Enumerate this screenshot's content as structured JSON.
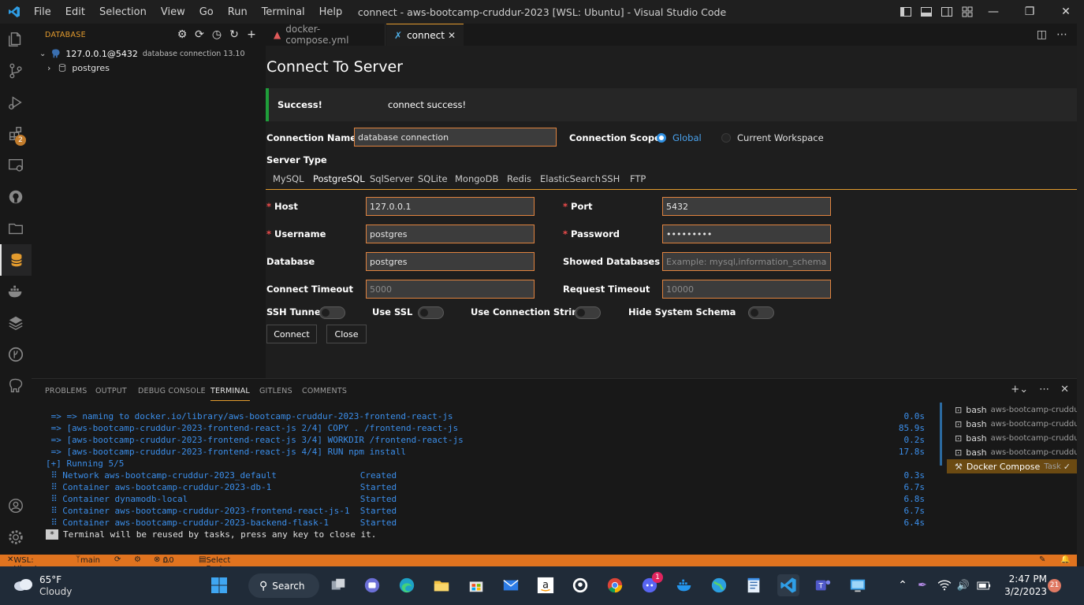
{
  "window": {
    "title": "connect - aws-bootcamp-cruddur-2023 [WSL: Ubuntu] - Visual Studio Code",
    "menu": [
      "File",
      "Edit",
      "Selection",
      "View",
      "Go",
      "Run",
      "Terminal",
      "Help"
    ]
  },
  "sidebar": {
    "title": "DATABASE",
    "connection": {
      "name": "127.0.0.1@5432",
      "detail": "database connection 13.10"
    },
    "db_item": "postgres",
    "extensions_badge": "2"
  },
  "tabs": [
    {
      "label": "docker-compose.yml",
      "icon": "docker-whale-icon"
    },
    {
      "label": "connect",
      "icon": "connect-plug-icon"
    }
  ],
  "form": {
    "heading": "Connect To Server",
    "success_label": "Success!",
    "success_msg": "connect success!",
    "conn_name_label": "Connection Name",
    "conn_name_value": "database connection",
    "scope_label": "Connection Scope",
    "scope_global": "Global",
    "scope_workspace": "Current Workspace",
    "server_type_label": "Server Type",
    "server_types": [
      "MySQL",
      "PostgreSQL",
      "SqlServer",
      "SQLite",
      "MongoDB",
      "Redis",
      "ElasticSearch",
      "SSH",
      "FTP"
    ],
    "host_label": "Host",
    "host_value": "127.0.0.1",
    "port_label": "Port",
    "port_value": "5432",
    "user_label": "Username",
    "user_value": "postgres",
    "pass_label": "Password",
    "pass_value": "•••••••••",
    "db_label": "Database",
    "db_value": "postgres",
    "showdb_label": "Showed Databases",
    "showdb_placeholder": "Example: mysql,information_schema",
    "ctimeout_label": "Connect Timeout",
    "ctimeout_value": "5000",
    "rtimeout_label": "Request Timeout",
    "rtimeout_value": "10000",
    "ssh_tunnel": "SSH Tunnel",
    "use_ssl": "Use SSL",
    "use_conn_string": "Use Connection String",
    "hide_schema": "Hide System Schema",
    "connect_btn": "Connect",
    "close_btn": "Close"
  },
  "panel": {
    "tabs": [
      "PROBLEMS",
      "OUTPUT",
      "DEBUG CONSOLE",
      "TERMINAL",
      "GITLENS",
      "COMMENTS"
    ],
    "lines": [
      {
        "text": " => => naming to docker.io/library/aws-bootcamp-cruddur-2023-frontend-react-js",
        "time": "0.0s"
      },
      {
        "text": " => [aws-bootcamp-cruddur-2023-frontend-react-js 2/4] COPY . /frontend-react-js",
        "time": "85.9s"
      },
      {
        "text": " => [aws-bootcamp-cruddur-2023-frontend-react-js 3/4] WORKDIR /frontend-react-js",
        "time": "0.2s"
      },
      {
        "text": " => [aws-bootcamp-cruddur-2023-frontend-react-js 4/4] RUN npm install",
        "time": "17.8s"
      },
      {
        "text": "[+] Running 5/5",
        "time": ""
      },
      {
        "text": " ⠿ Network aws-bootcamp-cruddur-2023_default                Created",
        "time": "0.3s"
      },
      {
        "text": " ⠿ Container aws-bootcamp-cruddur-2023-db-1                 Started",
        "time": "6.7s"
      },
      {
        "text": " ⠿ Container dynamodb-local                                 Started",
        "time": "6.8s"
      },
      {
        "text": " ⠿ Container aws-bootcamp-cruddur-2023-frontend-react-js-1  Started",
        "time": "6.7s"
      },
      {
        "text": " ⠿ Container aws-bootcamp-cruddur-2023-backend-flask-1      Started",
        "time": "6.4s"
      }
    ],
    "reuse_msg": "Terminal will be reused by tasks, press any key to close it.",
    "terminals": [
      {
        "name": "bash",
        "sub": "aws-bootcamp-cruddur..."
      },
      {
        "name": "bash",
        "sub": "aws-bootcamp-cruddur..."
      },
      {
        "name": "bash",
        "sub": "aws-bootcamp-cruddur..."
      },
      {
        "name": "bash",
        "sub": "aws-bootcamp-cruddur..."
      },
      {
        "name": "Docker Compose",
        "sub": "Task"
      }
    ]
  },
  "status": {
    "remote": "WSL: Ubuntu",
    "branch": "main",
    "errors": "0",
    "warnings": "0",
    "task": "Select Postgres Server"
  },
  "taskbar": {
    "temp": "65°F",
    "weather": "Cloudy",
    "search": "Search",
    "discord_badge": "1",
    "time": "2:47 PM",
    "date": "3/2/2023",
    "notif": "21"
  }
}
